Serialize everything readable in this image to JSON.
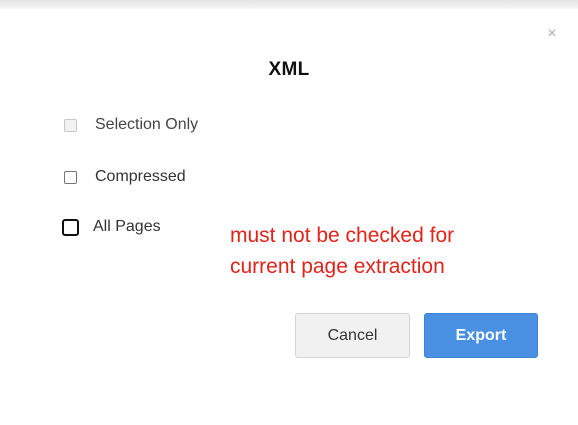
{
  "dialog": {
    "title": "XML",
    "close_icon": "close-icon",
    "options": {
      "selection_only": {
        "label": "Selection Only",
        "checked": false,
        "disabled": true
      },
      "compressed": {
        "label": "Compressed",
        "checked": false,
        "disabled": false
      },
      "all_pages": {
        "label": "All Pages",
        "checked": false,
        "disabled": false
      }
    },
    "buttons": {
      "cancel": "Cancel",
      "export": "Export"
    }
  },
  "annotation": {
    "line1": "must not be checked for",
    "line2": "current page extraction",
    "color": "#e2231a"
  },
  "colors": {
    "export_button": "#4a90e2",
    "cancel_button": "#f1f1f1"
  }
}
